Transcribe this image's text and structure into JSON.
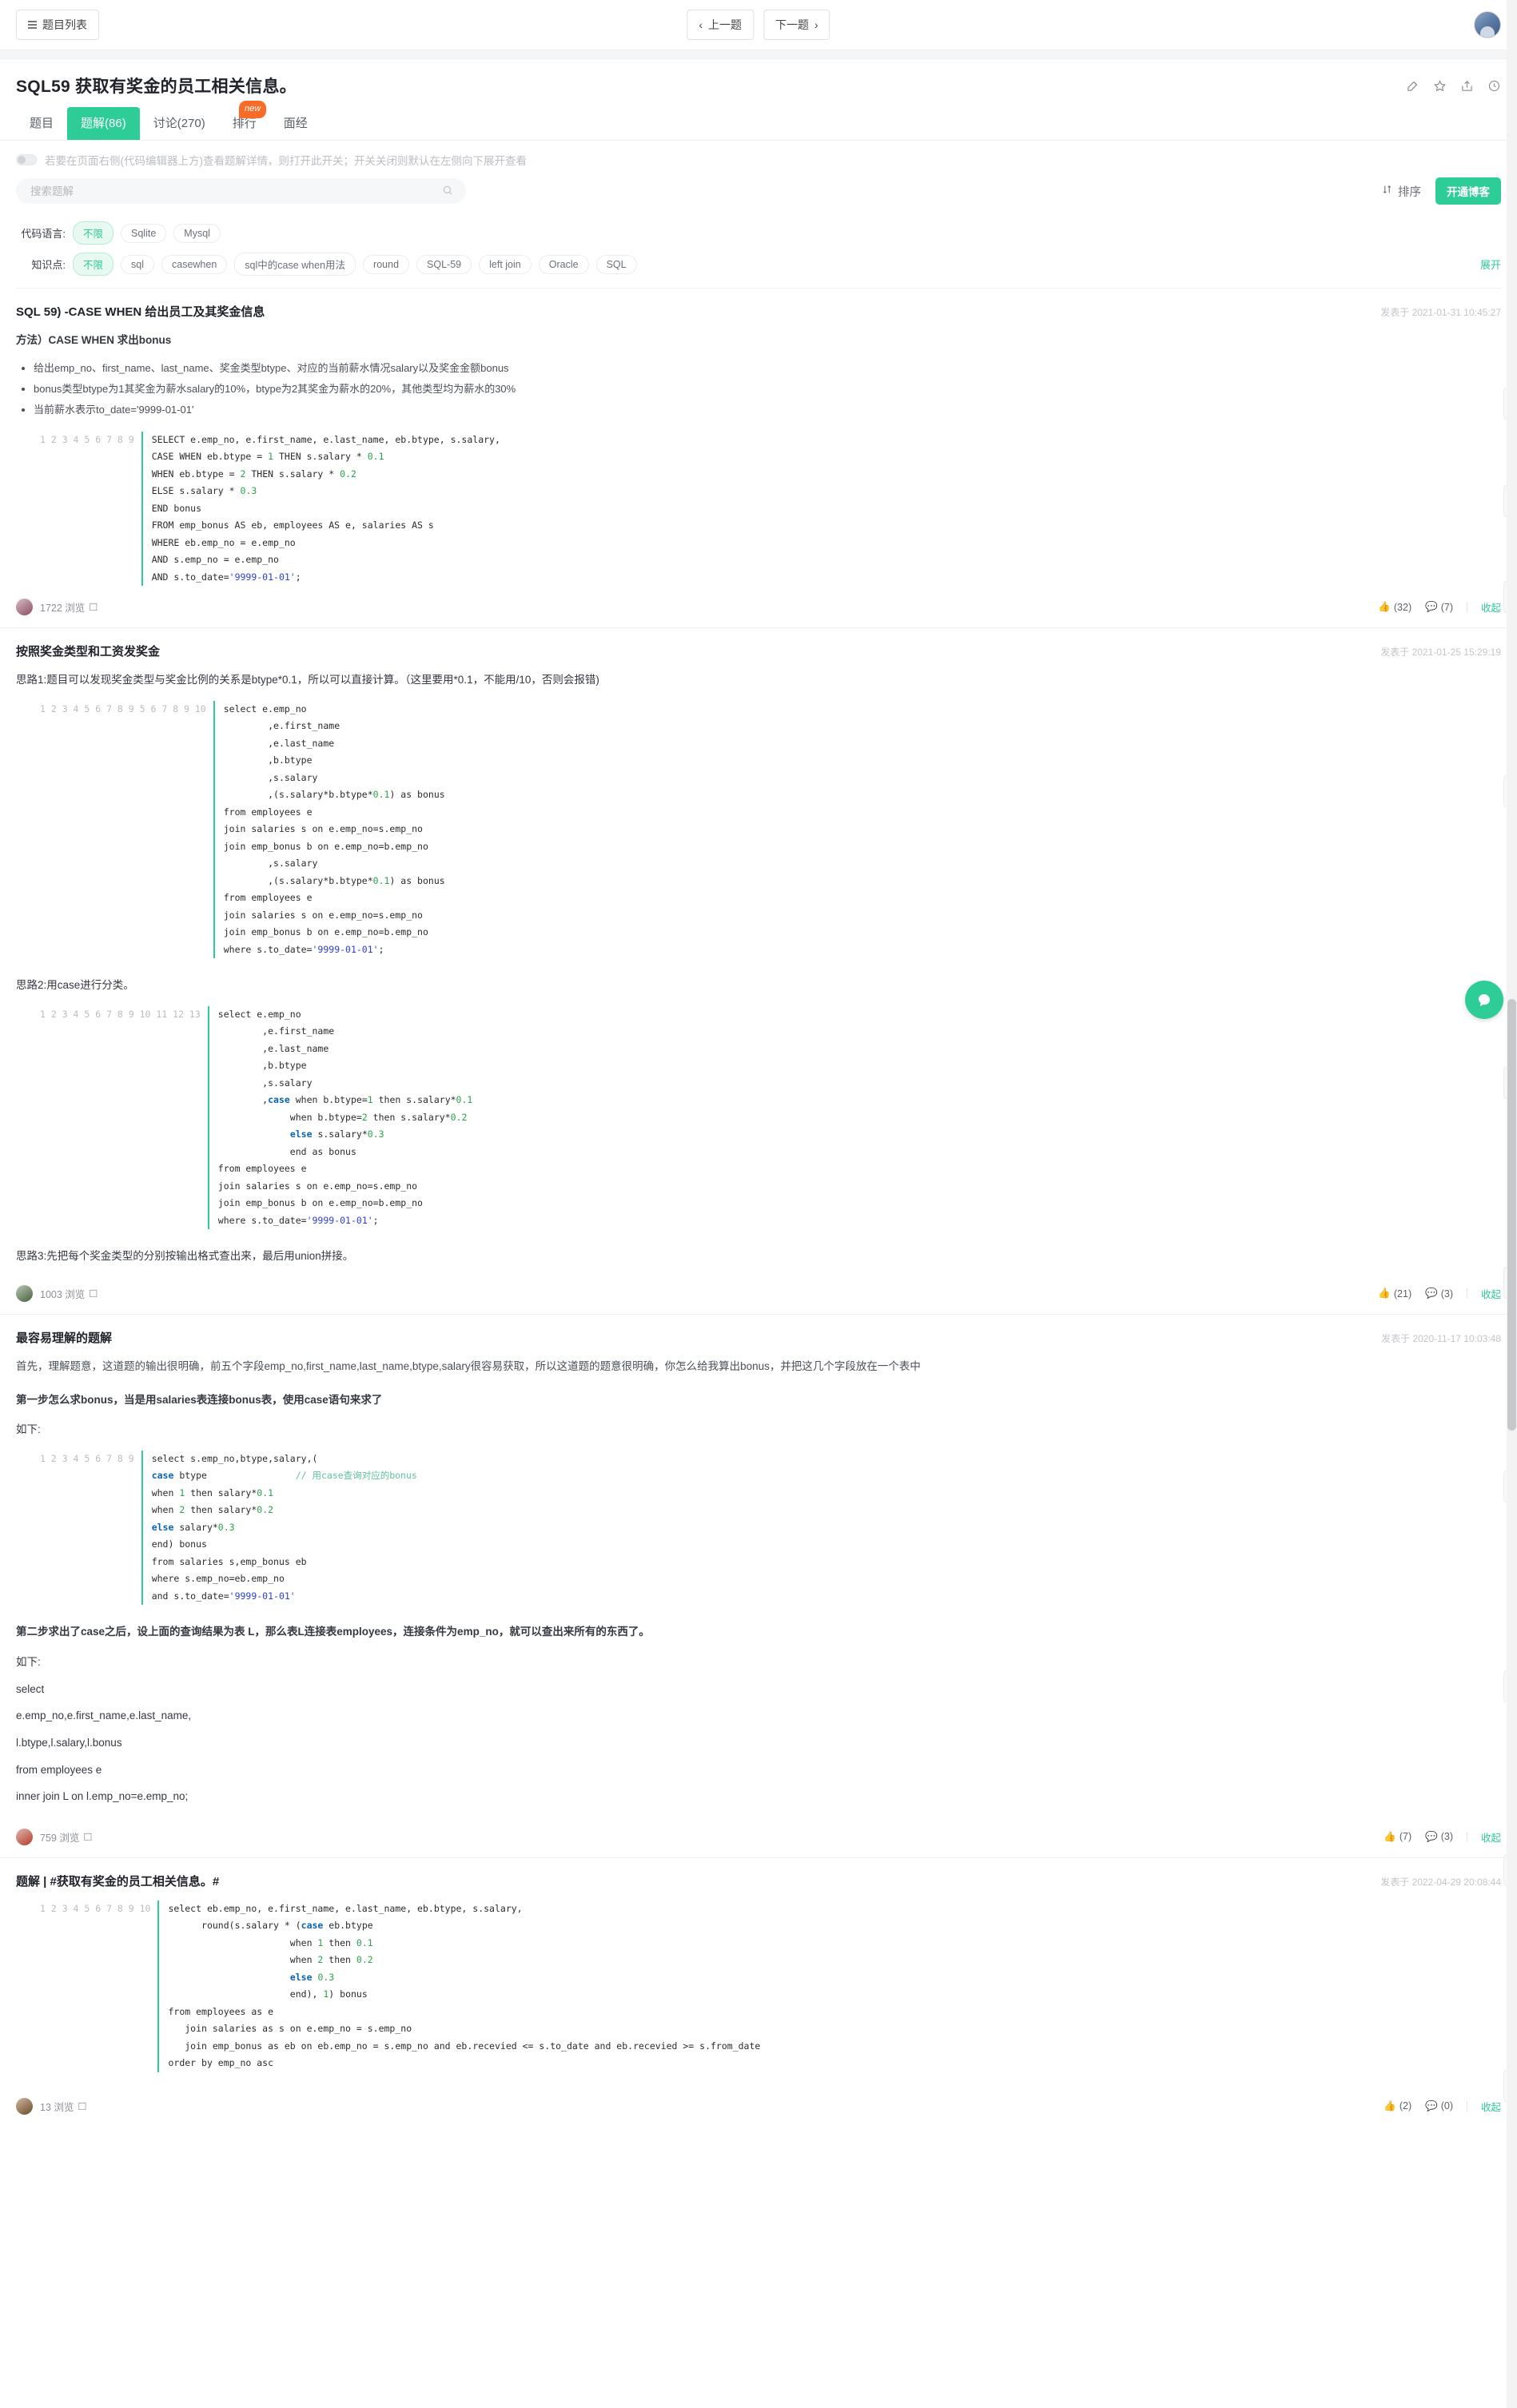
{
  "topbar": {
    "list_button": "题目列表",
    "prev_button": "上一题",
    "next_button": "下一题"
  },
  "header": {
    "title": "SQL59  获取有奖金的员工相关信息。",
    "tabs": [
      {
        "label": "题目",
        "active": false
      },
      {
        "label": "题解(86)",
        "active": true
      },
      {
        "label": "讨论(270)",
        "active": false
      },
      {
        "label": "排行",
        "active": false
      },
      {
        "label": "面经",
        "active": false
      }
    ],
    "badge": "new",
    "icons": [
      "edit-icon",
      "star-icon",
      "share-icon",
      "clock-icon"
    ]
  },
  "notice": {
    "text": "若要在页面右侧(代码编辑器上方)查看题解详情，则打开此开关；开关关闭则默认在左侧向下展开查看",
    "switch_state": "off"
  },
  "search": {
    "placeholder": "搜索题解",
    "value": "",
    "icon": "search-icon",
    "sort_label": "排序",
    "sort_icon": "sort-icon",
    "blog_button": "开通博客"
  },
  "filters": {
    "rows": [
      {
        "label": "代码语言:",
        "chips": [
          {
            "label": "不限",
            "active": true
          },
          {
            "label": "Sqlite",
            "active": false
          },
          {
            "label": "Mysql",
            "active": false
          }
        ],
        "expand": ""
      },
      {
        "label": "知识点:",
        "chips": [
          {
            "label": "不限",
            "active": true
          },
          {
            "label": "sql",
            "active": false
          },
          {
            "label": "casewhen",
            "active": false
          },
          {
            "label": "sql中的case when用法",
            "active": false
          },
          {
            "label": "round",
            "active": false
          },
          {
            "label": "SQL-59",
            "active": false
          },
          {
            "label": "left join",
            "active": false
          },
          {
            "label": "Oracle",
            "active": false
          },
          {
            "label": "SQL",
            "active": false
          }
        ],
        "expand": "展开"
      }
    ]
  },
  "posts": [
    {
      "title": "SQL 59) -CASE WHEN 给出员工及其奖金信息",
      "time": "发表于 2021-01-31 10:45:27",
      "subtitle": "方法）CASE WHEN 求出bonus",
      "bullets": [
        "给出emp_no、first_name、last_name、奖金类型btype、对应的当前薪水情况salary以及奖金金额bonus",
        "bonus类型btype为1其奖金为薪水salary的10%，btype为2其奖金为薪水的20%，其他类型均为薪水的30%",
        "当前薪水表示to_date='9999-01-01'"
      ],
      "views": "1722 浏览",
      "likes": "(32)",
      "comments": "(7)",
      "collapse": "收起"
    },
    {
      "title": "按照奖金类型和工资发奖金",
      "time": "发表于 2021-01-25 15:29:19",
      "idea1": "思路1:题目可以发现奖金类型与奖金比例的关系是btype*0.1，所以可以直接计算。（这里要用*0.1，不能用/10，否则会报错)",
      "idea2": "思路2:用case进行分类。",
      "idea3": "思路3:先把每个奖金类型的分别按输出格式查出来，最后用union拼接。",
      "views": "1003 浏览",
      "likes": "(21)",
      "comments": "(3)",
      "collapse": "收起"
    },
    {
      "title": "最容易易理解的题解",
      "title_real": "最容易理解的题解",
      "time": "发表于 2020-11-17 10:03:48",
      "para1": "首先，理解题意，这道题的输出很明确，前五个字段emp_no,first_name,last_name,btype,salary很容易获取，所以这道题的题意很明确，你怎么给我算出bonus，并把这几个字段放在一个表中",
      "para2": "第一步怎么求bonus，当是用salaries表连接bonus表，使用case语句来求了",
      "para3": "如下:",
      "para4": "第二步求出了case之后，设上面的查询结果为表 L，那么表L连接表employees，连接条件为emp_no，就可以查出来所有的东西了。",
      "para5": "如下:",
      "sqltext": [
        "select",
        "e.emp_no,e.first_name,e.last_name,",
        "l.btype,l.salary,l.bonus",
        "from employees e",
        "inner join L on l.emp_no=e.emp_no;"
      ],
      "views": "759 浏览",
      "likes": "(7)",
      "comments": "(3)",
      "collapse": "收起"
    },
    {
      "title": "题解 | #获取有奖金的员工相关信息。#",
      "time": "发表于 2022-04-29 20:08:44",
      "views": "13 浏览",
      "likes": "(2)",
      "comments": "(0)",
      "collapse": "收起"
    }
  ],
  "code_blocks": {
    "b1": {
      "lines": [
        "1",
        "2",
        "3",
        "4",
        "5",
        "6",
        "7",
        "8",
        "9"
      ],
      "text": "SELECT e.emp_no, e.first_name, e.last_name, eb.btype, s.salary,\nCASE WHEN eb.btype = 1 THEN s.salary * 0.1\nWHEN eb.btype = 2 THEN s.salary * 0.2\nELSE s.salary * 0.3\nEND bonus\nFROM emp_bonus AS eb, employees AS e, salaries AS s\nWHERE eb.emp_no = e.emp_no\nAND s.emp_no = e.emp_no\nAND s.to_date='9999-01-01';"
    },
    "b2": {
      "lines": [
        "1",
        "2",
        "3",
        "4",
        "5",
        "6",
        "7",
        "8",
        "9",
        "5",
        "6",
        "7",
        "8",
        "9",
        "10"
      ],
      "text": "select e.emp_no\n        ,e.first_name\n        ,e.last_name\n        ,b.btype\n        ,s.salary\n        ,(s.salary*b.btype*0.1) as bonus\nfrom employees e\njoin salaries s on e.emp_no=s.emp_no\njoin emp_bonus b on e.emp_no=b.emp_no\n        ,s.salary\n        ,(s.salary*b.btype*0.1) as bonus\nfrom employees e\njoin salaries s on e.emp_no=s.emp_no\njoin emp_bonus b on e.emp_no=b.emp_no\nwhere s.to_date='9999-01-01';"
    },
    "b3": {
      "lines": [
        "1",
        "2",
        "3",
        "4",
        "5",
        "6",
        "7",
        "8",
        "9",
        "10",
        "11",
        "12",
        "13"
      ],
      "text": "select e.emp_no\n        ,e.first_name\n        ,e.last_name\n        ,b.btype\n        ,s.salary\n        ,case when b.btype=1 then s.salary*0.1\n             when b.btype=2 then s.salary*0.2\n             else s.salary*0.3\n             end as bonus\nfrom employees e\njoin salaries s on e.emp_no=s.emp_no\njoin emp_bonus b on e.emp_no=b.emp_no\nwhere s.to_date='9999-01-01';"
    },
    "b4": {
      "lines": [
        "1",
        "2",
        "3",
        "4",
        "5",
        "6",
        "7",
        "8",
        "9"
      ],
      "text": "select s.emp_no,btype,salary,(\ncase btype                // 用case查询对应的bonus\nwhen 1 then salary*0.1\nwhen 2 then salary*0.2\nelse salary*0.3\nend) bonus\nfrom salaries s,emp_bonus eb\nwhere s.emp_no=eb.emp_no\nand s.to_date='9999-01-01'"
    },
    "b5": {
      "lines": [
        "1",
        "2",
        "3",
        "4",
        "5",
        "6",
        "7",
        "8",
        "9",
        "10"
      ],
      "text": "select eb.emp_no, e.first_name, e.last_name, eb.btype, s.salary,\n      round(s.salary * (case eb.btype\n                      when 1 then 0.1\n                      when 2 then 0.2\n                      else 0.3\n                      end), 1) bonus\nfrom employees as e\n   join salaries as s on e.emp_no = s.emp_no\n   join emp_bonus as eb on eb.emp_no = s.emp_no and eb.recevied <= s.to_date and eb.recevied >= s.from_date\norder by emp_no asc"
    }
  },
  "colors": {
    "accent": "#2ecc96",
    "badge": "#f86c28"
  }
}
